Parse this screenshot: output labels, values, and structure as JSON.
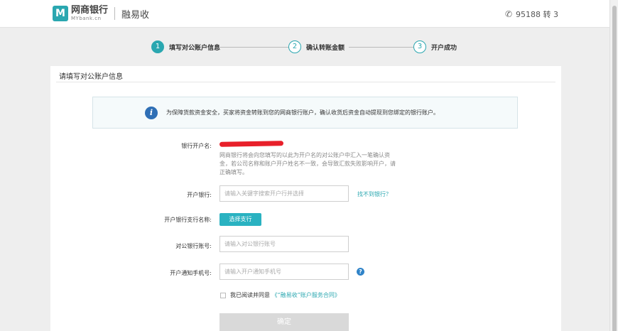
{
  "header": {
    "logo_mark": "M",
    "logo_name": "网商银行",
    "logo_domain": "MYbank.cn",
    "product": "融易收",
    "hotline_icon": "phone-icon",
    "hotline": "95188 转 3"
  },
  "steps": [
    {
      "num": "1",
      "label": "填写对公账户信息",
      "active": true
    },
    {
      "num": "2",
      "label": "确认转账金额",
      "active": false
    },
    {
      "num": "3",
      "label": "开户成功",
      "active": false
    }
  ],
  "panel": {
    "title": "请填写对公账户信息",
    "notice_icon": "info-icon",
    "notice_icon_glyph": "i",
    "notice": "为保障货款资金安全，买家将资金转账到您的网商银行账户，确认收货后资金自动提现到您绑定的银行账户。"
  },
  "form": {
    "account_name_label": "银行开户名:",
    "account_name_value": "[redacted]",
    "account_name_hint": "网商银行将会向您填写的以此为开户名的对公账户中汇入一笔确认资金，若公司名称和账户开户姓名不一致，会导致汇款失败影响开户，请正确填写。",
    "bank_label": "开户银行:",
    "bank_placeholder": "请输入关键字搜索开户行并选择",
    "bank_not_found": "找不到银行？",
    "branch_label": "开户银行支行名称:",
    "branch_button": "选择支行",
    "account_no_label": "对公银行账号:",
    "account_no_placeholder": "请输入对公银行账号",
    "phone_label": "开户通知手机号:",
    "phone_placeholder": "请输入开户通知手机号",
    "help_icon": "question-icon",
    "help_glyph": "?",
    "agree_prefix": "我已阅读并同意",
    "agree_contract": "《“融易收”账户服务合同》",
    "agree_checked": false,
    "confirm_button": "确定"
  },
  "colors": {
    "accent": "#2aa7b0",
    "button_teal": "#2ab2c1",
    "info_blue": "#2f6fb5",
    "disabled": "#d9d9d9"
  }
}
